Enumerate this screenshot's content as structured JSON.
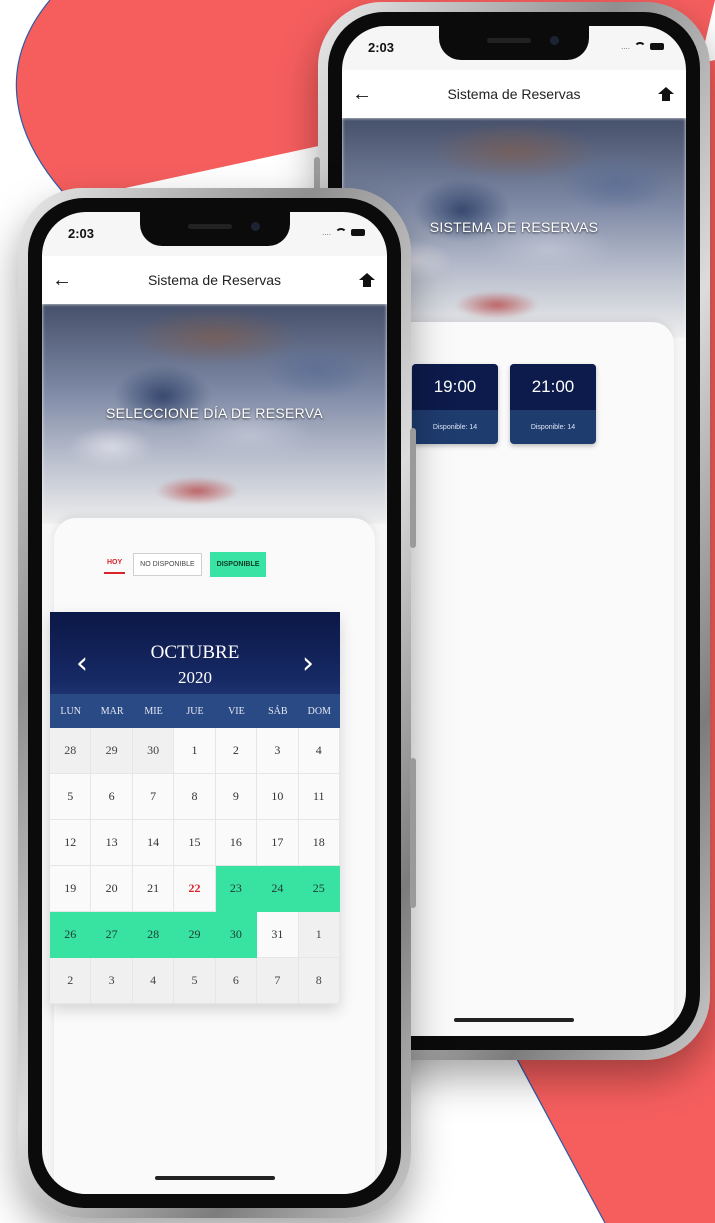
{
  "colors": {
    "background_accent": "#f65e5e",
    "available": "#39e3a3",
    "today": "#d9252a",
    "calendar_header": "#0b1746",
    "slot_time_bg": "#0d1b4c"
  },
  "back_phone": {
    "status_time": "2:03",
    "nav": {
      "back_icon": "arrow-left-icon",
      "title": "Sistema de Reservas",
      "home_icon": "home-icon"
    },
    "hero_label": "SISTEMA DE RESERVAS",
    "slots": [
      {
        "time": "19:00",
        "availability": "Disponible: 14"
      },
      {
        "time": "21:00",
        "availability": "Disponible: 14"
      }
    ]
  },
  "front_phone": {
    "status_time": "2:03",
    "nav": {
      "back_icon": "arrow-left-icon",
      "title": "Sistema de Reservas",
      "home_icon": "home-icon"
    },
    "hero_label": "SELECCIONE DÍA DE RESERVA",
    "legend": {
      "today": "HOY",
      "unavailable": "NO DISPONIBLE",
      "available": "DISPONIBLE"
    },
    "calendar": {
      "prev_icon": "chevron-left-icon",
      "next_icon": "chevron-right-icon",
      "month": "OCTUBRE",
      "year": "2020",
      "weekdays": [
        "LUN",
        "MAR",
        "MIE",
        "JUE",
        "VIE",
        "SÁB",
        "DOM"
      ],
      "weeks": [
        [
          "28",
          "29",
          "30",
          "1",
          "2",
          "3",
          "4"
        ],
        [
          "5",
          "6",
          "7",
          "8",
          "9",
          "10",
          "11"
        ],
        [
          "12",
          "13",
          "14",
          "15",
          "16",
          "17",
          "18"
        ],
        [
          "19",
          "20",
          "21",
          "22",
          "23",
          "24",
          "25"
        ],
        [
          "26",
          "27",
          "28",
          "29",
          "30",
          "31",
          "1"
        ],
        [
          "2",
          "3",
          "4",
          "5",
          "6",
          "7",
          "8"
        ]
      ],
      "today": "22",
      "available_days": [
        "23",
        "24",
        "25",
        "26",
        "27",
        "28",
        "29",
        "30"
      ]
    }
  }
}
